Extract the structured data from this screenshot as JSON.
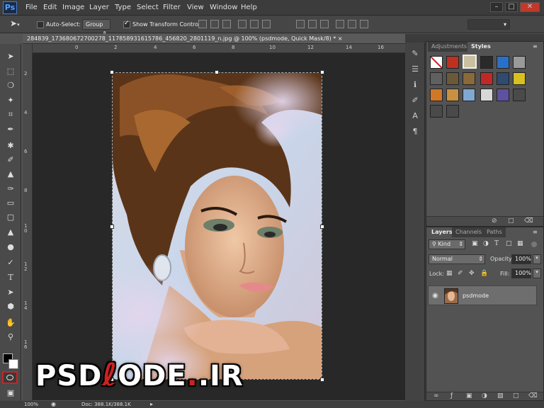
{
  "app": {
    "logo": "Ps"
  },
  "menu": [
    "File",
    "Edit",
    "Image",
    "Layer",
    "Type",
    "Select",
    "Filter",
    "View",
    "Window",
    "Help"
  ],
  "window_controls": {
    "minimize": "–",
    "restore": "□",
    "close": "✕"
  },
  "options": {
    "auto_select_label": "Auto-Select:",
    "auto_select_value": "Group",
    "transform_label": "Show Transform Controls"
  },
  "document": {
    "tab_title": "284839_173680672700278_117858931615786_456820_2801119_n.jpg @ 100% (psdmode, Quick Mask/8) *",
    "close": "×"
  },
  "ruler": {
    "top": [
      "0",
      "2",
      "4",
      "6",
      "8",
      "10",
      "12",
      "14",
      "16"
    ],
    "left": [
      "2",
      "4",
      "6",
      "8",
      "1\n0",
      "1\n2",
      "1\n4",
      "1\n6"
    ]
  },
  "status": {
    "zoom": "100%",
    "doc": "Doc: 388.1K/388.1K"
  },
  "panels": {
    "styles_tabs": [
      "Adjustments",
      "Styles"
    ],
    "layers_tabs": [
      "Layers",
      "Channels",
      "Paths"
    ],
    "kind_label": "Kind",
    "blend_mode": "Normal",
    "opacity_label": "Opacity:",
    "opacity_value": "100%",
    "lock_label": "Lock:",
    "fill_label": "Fill:",
    "fill_value": "100%",
    "layer_name": "psdmode"
  },
  "watermark": {
    "text": "PSDMODE.IR",
    "main": "PSD",
    "mid": "ODE",
    "tld": ".IR"
  },
  "colors": {
    "accent": "#cc2222",
    "ps_blue": "#4fa3ff"
  }
}
